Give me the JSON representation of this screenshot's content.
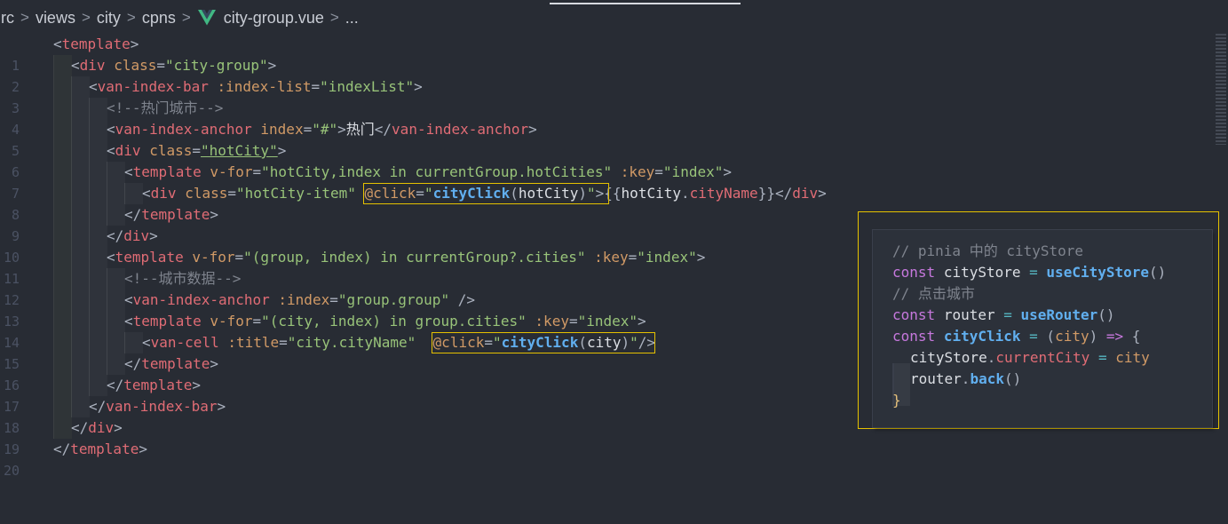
{
  "breadcrumb": {
    "segments": [
      "rc",
      "views",
      "city",
      "cpns"
    ],
    "file": "city-group.vue",
    "tail": "...",
    "separator": ">"
  },
  "colors": {
    "background": "#282c34",
    "highlight_box": "#e5c100",
    "vue_green": "#41b883",
    "vue_dark": "#35495e"
  },
  "icons": {
    "file_icon": "vue-logo-icon"
  },
  "code": {
    "line_numbers": [
      "1",
      "2",
      "3",
      "4",
      "5",
      "6",
      "7",
      "8",
      "9",
      "10",
      "11",
      "12",
      "13",
      "14",
      "15",
      "16",
      "17",
      "18",
      "19",
      "20"
    ],
    "line_1": [
      "<",
      "template",
      ">"
    ],
    "line_2": [
      "<",
      "div",
      " ",
      "class",
      "=",
      "\"city-group\"",
      ">"
    ],
    "line_3": [
      "<",
      "van-index-bar",
      " ",
      ":index-list",
      "=",
      "\"indexList\"",
      ">"
    ],
    "line_4": [
      "<!--热门城市-->"
    ],
    "line_5": [
      "<",
      "van-index-anchor",
      " ",
      "index",
      "=",
      "\"#\"",
      ">",
      "热门",
      "</",
      "van-index-anchor",
      ">"
    ],
    "line_6": [
      "<",
      "div",
      " ",
      "class",
      "=",
      "\"hotCity\"",
      ">"
    ],
    "line_7": [
      "<",
      "template",
      " ",
      "v-for",
      "=",
      "\"hotCity,index in currentGroup.hotCities\"",
      " ",
      ":key",
      "=",
      "\"index\"",
      ">"
    ],
    "line_8": [
      "<",
      "div",
      " ",
      "class",
      "=",
      "\"hotCity-item\"",
      " ",
      "@click",
      "=",
      "\"",
      "cityClick",
      "(",
      "hotCity",
      ")",
      "\"",
      ">",
      "{{",
      "hotCity",
      ".",
      "cityName",
      "}}",
      "</",
      "div",
      ">"
    ],
    "line_9": [
      "</",
      "template",
      ">"
    ],
    "line_10": [
      "</",
      "div",
      ">"
    ],
    "line_11": [
      "<",
      "template",
      " ",
      "v-for",
      "=",
      "\"(group, index) in currentGroup?.cities\"",
      " ",
      ":key",
      "=",
      "\"index\"",
      ">"
    ],
    "line_12": [
      "<!--城市数据-->"
    ],
    "line_13": [
      "<",
      "van-index-anchor",
      " ",
      ":index",
      "=",
      "\"group.group\"",
      " ",
      "/>"
    ],
    "line_14": [
      "<",
      "template",
      " ",
      "v-for",
      "=",
      "\"(city, index) in group.cities\"",
      " ",
      ":key",
      "=",
      "\"index\"",
      ">"
    ],
    "line_15": [
      "<",
      "van-cell",
      " ",
      ":title",
      "=",
      "\"city.cityName\"",
      "  ",
      "@click",
      "=",
      "\"",
      "cityClick",
      "(",
      "city",
      ")",
      "\"",
      "/>"
    ],
    "line_16": [
      "</",
      "template",
      ">"
    ],
    "line_17": [
      "</",
      "template",
      ">"
    ],
    "line_18": [
      "</",
      "van-index-bar",
      ">"
    ],
    "line_19": [
      "</",
      "div",
      ">"
    ],
    "line_20": [
      "</",
      "template",
      ">"
    ]
  },
  "popup": {
    "line_1": [
      "// pinia 中的 cityStore"
    ],
    "line_2": [
      "const",
      " ",
      "cityStore",
      " = ",
      "useCityStore",
      "()"
    ],
    "line_3": [
      "// 点击城市"
    ],
    "line_4": [
      "const",
      " ",
      "router",
      " = ",
      "useRouter",
      "()"
    ],
    "line_5": [
      "const",
      " ",
      "cityClick",
      " = ",
      "(",
      "city",
      ")",
      " => ",
      "{"
    ],
    "line_6": [
      "cityStore",
      ".",
      "currentCity",
      " = ",
      "city"
    ],
    "line_7": [
      "router",
      ".",
      "back",
      "()"
    ],
    "line_8": [
      "}"
    ]
  }
}
